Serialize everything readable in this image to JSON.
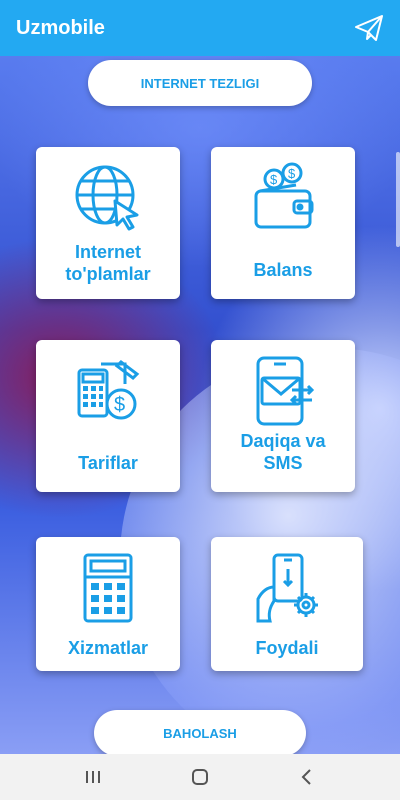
{
  "app": {
    "title": "Uzmobile"
  },
  "actions": {
    "internet_speed": "INTERNET TEZLIGI",
    "rate": "BAHOLASH"
  },
  "menu": [
    {
      "label": "Internet to'plamlar",
      "icon": "globe-cursor-icon"
    },
    {
      "label": "Balans",
      "icon": "wallet-coins-icon"
    },
    {
      "label": "Tariflar",
      "icon": "calculator-coin-icon"
    },
    {
      "label": "Daqiqa va SMS",
      "icon": "phone-envelope-icon"
    },
    {
      "label": "Xizmatlar",
      "icon": "keypad-terminal-icon"
    },
    {
      "label": "Foydali",
      "icon": "hand-phone-gear-icon"
    }
  ],
  "system_nav": [
    "recents-icon",
    "home-icon",
    "back-icon"
  ],
  "colors": {
    "accent": "#1a9ee6",
    "topbar": "#23a9f2",
    "card": "#ffffff"
  }
}
